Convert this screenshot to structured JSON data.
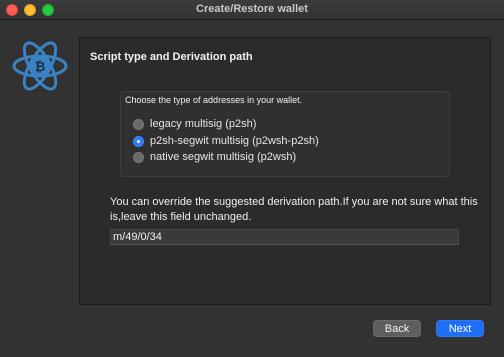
{
  "window": {
    "title": "Create/Restore wallet"
  },
  "colors": {
    "accent": "#1f6ff5",
    "logo": "#3b82c4"
  },
  "panel": {
    "title": "Script type and Derivation path",
    "group_label": "Choose the type of addresses in your wallet.",
    "options": [
      {
        "label": "legacy multisig (p2sh)",
        "checked": false
      },
      {
        "label": "p2sh-segwit multisig (p2wsh-p2sh)",
        "checked": true
      },
      {
        "label": "native segwit multisig (p2wsh)",
        "checked": false
      }
    ],
    "override_text": "You can override the suggested derivation path.If you are not sure what this is,leave this field unchanged.",
    "derivation_path": "m/49/0/34"
  },
  "buttons": {
    "back": "Back",
    "next": "Next"
  }
}
